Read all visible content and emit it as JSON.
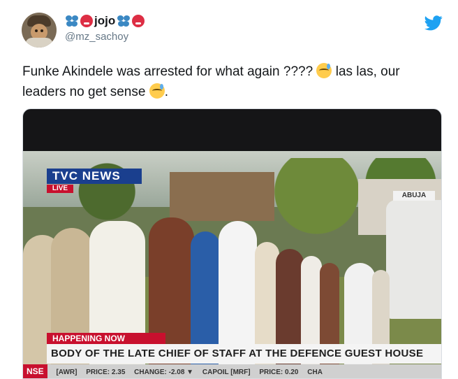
{
  "tweet": {
    "display_name": "jojo",
    "handle": "@mz_sachoy",
    "text_line1": "Funke Akindele was arrested for what again ????",
    "text_line1_after": "las las, our",
    "text_line2": "leaders no get sense",
    "text_line2_after": "."
  },
  "icons": {
    "twitter": "twitter-bird-icon",
    "butterfly": "butterfly-emoji",
    "hot_face": "hot-face-emoji",
    "sweat": "grinning-sweat-emoji"
  },
  "colors": {
    "twitter_blue": "#1da1f2",
    "live_red": "#c8102e",
    "tv_blue": "#1a3f8e"
  },
  "broadcast": {
    "channel": "TVC NEWS",
    "live": "LIVE",
    "location": "ABUJA",
    "happening": "HAPPENING NOW",
    "headline": "BODY OF THE LATE CHIEF OF STAFF AT THE DEFENCE GUEST HOUSE",
    "ticker": {
      "exchange": "NSE",
      "items": [
        "[AWR]",
        "PRICE: 2.35",
        "CHANGE: -2.08 ▼",
        "CAPOIL [MRF]",
        "PRICE: 0.20",
        "CHA"
      ]
    }
  }
}
